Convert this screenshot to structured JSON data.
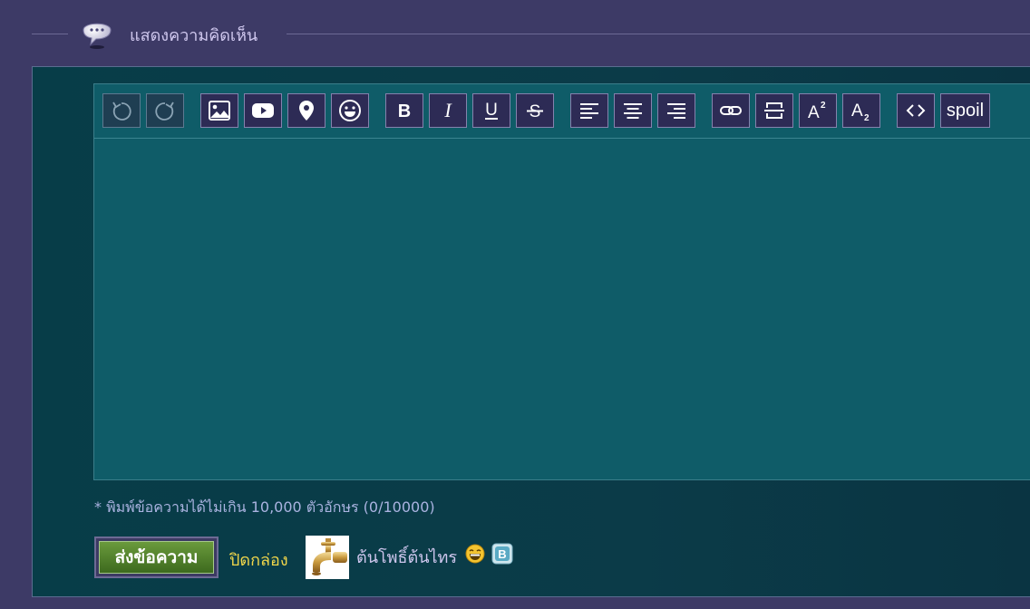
{
  "header": {
    "title": "แสดงความคิดเห็น"
  },
  "toolbar": {
    "buttons": [
      {
        "name": "undo-button",
        "icon": "undo-icon",
        "disabled": true
      },
      {
        "name": "redo-button",
        "icon": "redo-icon",
        "disabled": true
      },
      {
        "name": "insert-image-button",
        "icon": "image-icon"
      },
      {
        "name": "insert-youtube-button",
        "icon": "youtube-icon"
      },
      {
        "name": "insert-map-button",
        "icon": "map-pin-icon"
      },
      {
        "name": "insert-emoji-button",
        "icon": "smiley-icon"
      },
      {
        "name": "bold-button",
        "icon": "bold-icon"
      },
      {
        "name": "italic-button",
        "icon": "italic-icon"
      },
      {
        "name": "underline-button",
        "icon": "underline-icon"
      },
      {
        "name": "strikethrough-button",
        "icon": "strikethrough-icon"
      },
      {
        "name": "align-left-button",
        "icon": "align-left-icon"
      },
      {
        "name": "align-center-button",
        "icon": "align-center-icon"
      },
      {
        "name": "align-right-button",
        "icon": "align-right-icon"
      },
      {
        "name": "link-button",
        "icon": "link-icon"
      },
      {
        "name": "horizontal-rule-button",
        "icon": "horizontal-rule-icon"
      },
      {
        "name": "superscript-button",
        "icon": "superscript-icon"
      },
      {
        "name": "subscript-button",
        "icon": "subscript-icon"
      },
      {
        "name": "code-button",
        "icon": "code-icon"
      },
      {
        "name": "spoiler-button",
        "label": "spoil"
      }
    ]
  },
  "editor": {
    "value": ""
  },
  "hint": "* พิมพ์ข้อความได้ไม่เกิน 10,000 ตัวอักษร (0/10000)",
  "actions": {
    "send_label": "ส่งข้อความ",
    "close_label": "ปิดกล่อง"
  },
  "user": {
    "name": "ต้นโพธิ์ต้นไทร",
    "avatar_icon": "faucet-icon",
    "emoji_icon": "laughing-emoji-icon",
    "badge_icon": "blog-badge-icon"
  },
  "colors": {
    "background": "#3d3a66",
    "panel": "#0b3b48",
    "editor": "#0f5c68",
    "button": "#2d2b55",
    "send_button": "#4e7d2b",
    "close_link": "#f1d64a",
    "header_text": "#cfc7ee"
  }
}
